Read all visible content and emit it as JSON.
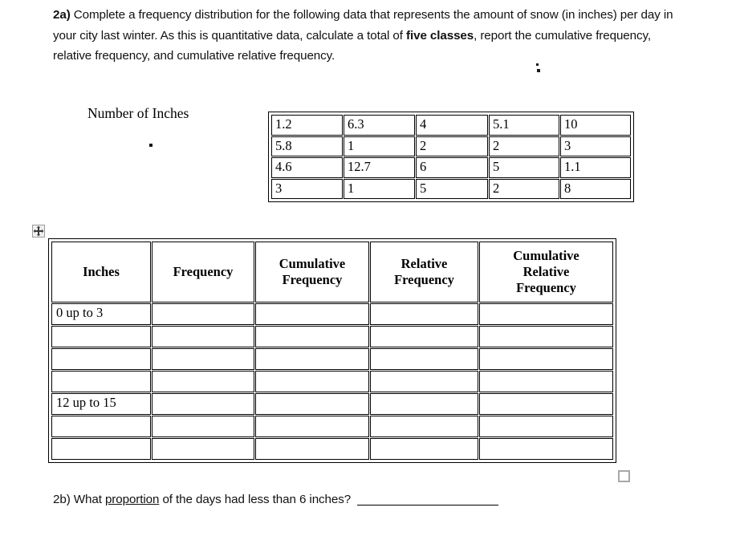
{
  "document": {
    "question_2a": {
      "number": "2a)",
      "text_part1": " Complete a frequency distribution for the following data that represents the amount of snow (in inches) per day in your city last winter.  As this is quantitative data, calculate a total of ",
      "bold_phrase": "five classes",
      "text_part2": ", report the cumulative frequency, relative frequency, and cumulative relative frequency."
    },
    "caption": "Number of Inches",
    "data_table": {
      "rows": [
        [
          "1.2",
          "6.3",
          "4",
          "5.1",
          "10"
        ],
        [
          "5.8",
          "1",
          "2",
          "2",
          "3"
        ],
        [
          "4.6",
          "12.7",
          "6",
          "5",
          "1.1"
        ],
        [
          "3",
          "1",
          "5",
          "2",
          "8"
        ]
      ]
    },
    "frequency_table": {
      "headers": [
        "Inches",
        "Frequency",
        "Cumulative Frequency",
        "Relative Frequency",
        "Cumulative Relative Frequency"
      ],
      "header_lines": [
        [
          "Inches"
        ],
        [
          "Frequency"
        ],
        [
          "Cumulative",
          "Frequency"
        ],
        [
          "Relative",
          "Frequency"
        ],
        [
          "Cumulative",
          "Relative",
          "Frequency"
        ]
      ],
      "rows": [
        [
          "0 up to 3",
          "",
          "",
          "",
          ""
        ],
        [
          "",
          "",
          "",
          "",
          ""
        ],
        [
          "",
          "",
          "",
          "",
          ""
        ],
        [
          "",
          "",
          "",
          "",
          ""
        ],
        [
          "12 up to 15",
          "",
          "",
          "",
          ""
        ],
        [
          "",
          "",
          "",
          "",
          ""
        ],
        [
          "",
          "",
          "",
          "",
          ""
        ]
      ]
    },
    "question_2b": {
      "number": "2b)",
      "text_before": "  What ",
      "underlined": "proportion",
      "text_after": " of the days had less than 6 inches?",
      "answer_value": ""
    },
    "handles": {
      "move_handle": "table-move-handle",
      "resize_handle": "table-resize-handle"
    }
  }
}
